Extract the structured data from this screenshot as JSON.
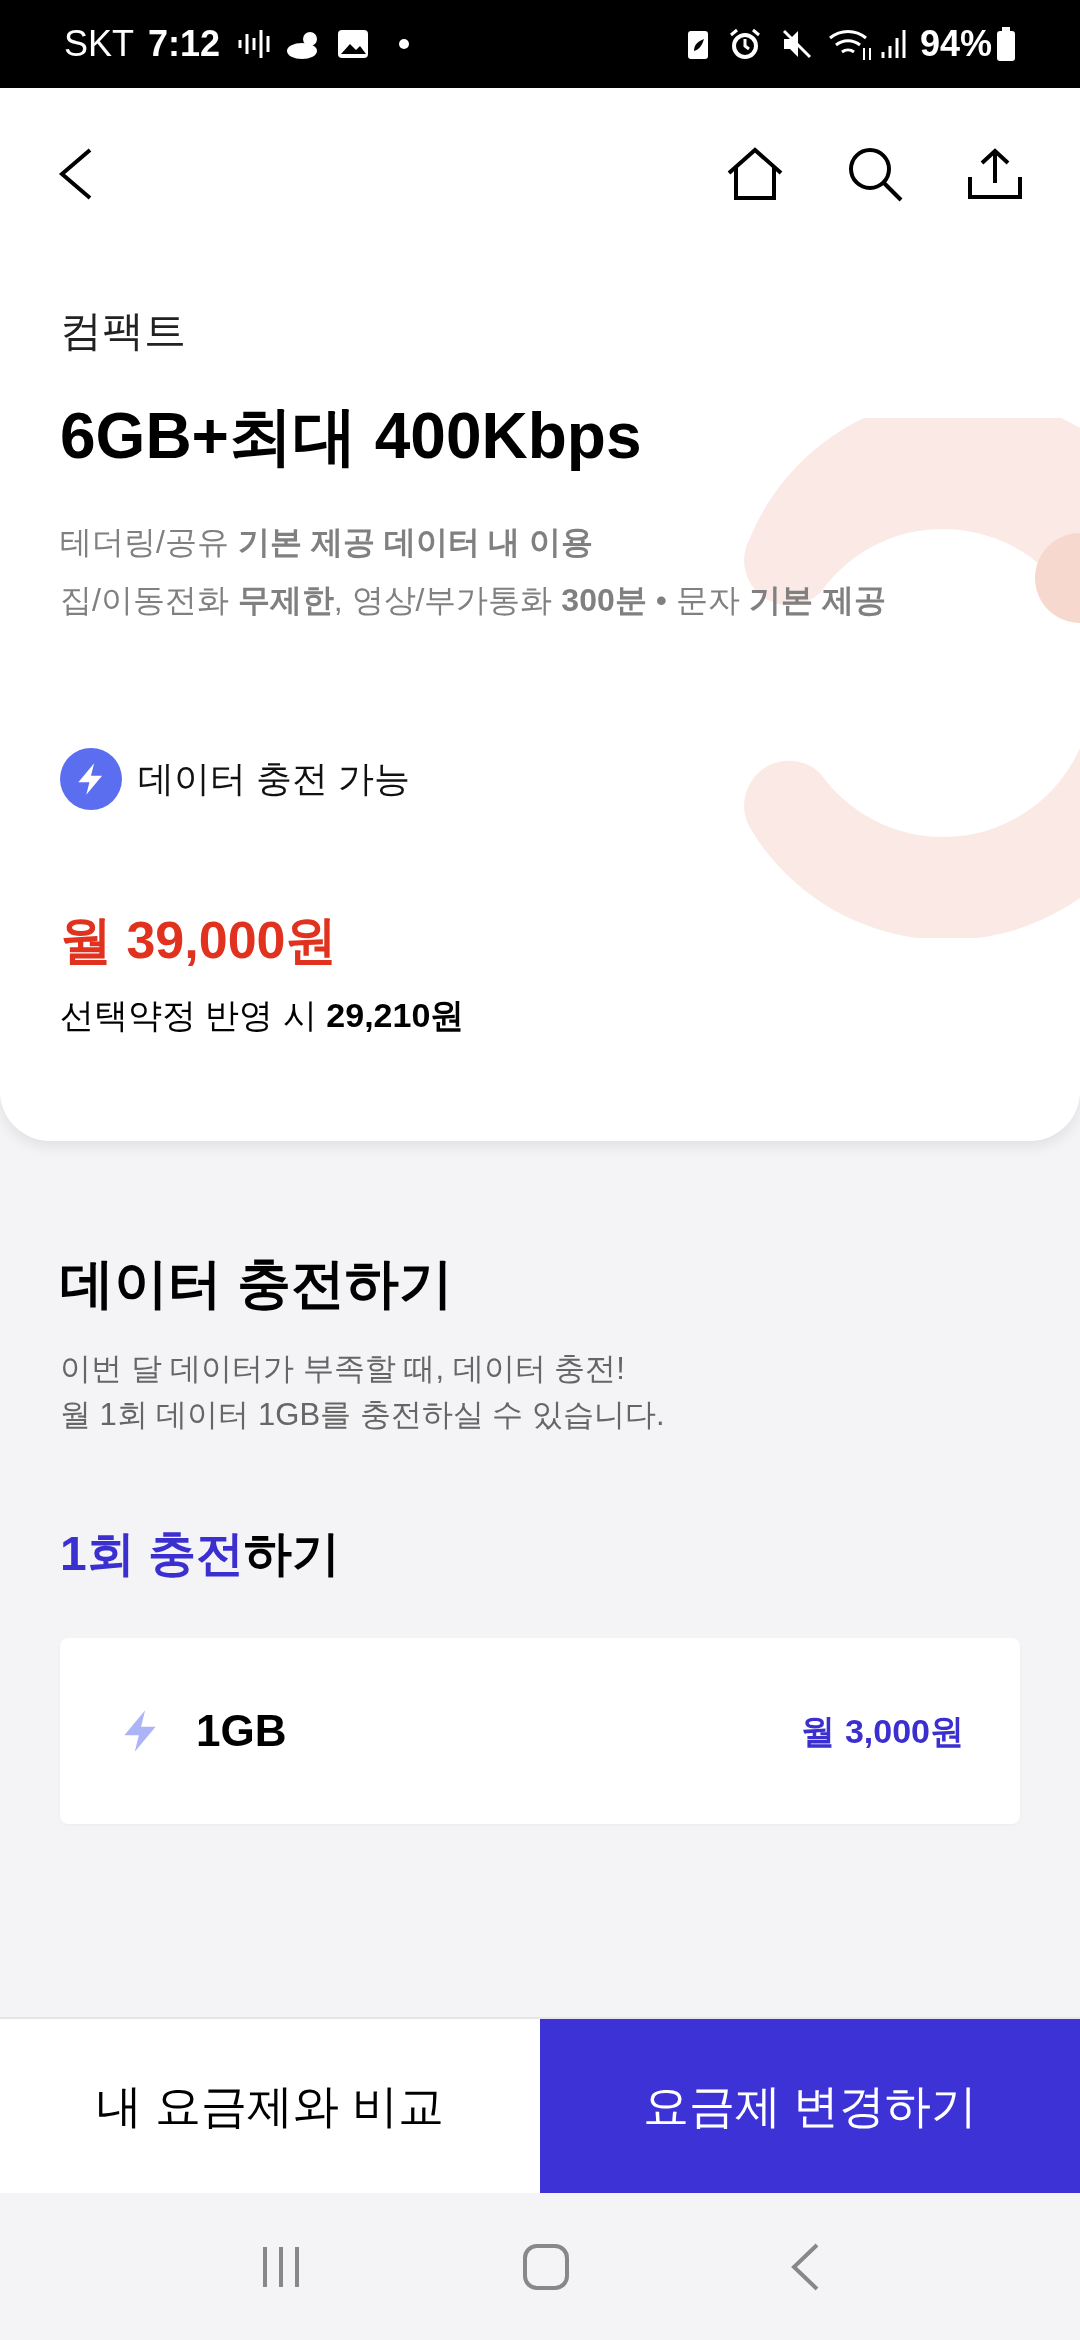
{
  "status_bar": {
    "carrier": "SKT",
    "time": "7:12",
    "battery": "94%"
  },
  "plan": {
    "category": "컴팩트",
    "title": "6GB+최대 400Kbps",
    "details": [
      "테더링/공유 **기본 제공 데이터 내 이용**",
      "집/이동전화 **무제한**, 영상/부가통화 **300분** • 문자 **기본 제공**"
    ],
    "feature": "데이터 충전 가능",
    "price": "월 39,000원",
    "discount": "선택약정 반영 시 **29,210원**"
  },
  "recharge": {
    "title": "데이터 충전하기",
    "description": [
      "이번 달 데이터가 부족할 때, 데이터 충전!",
      "월 1회 데이터 1GB를 충전하실 수 있습니다."
    ],
    "subtitle_highlight": "1회 충전",
    "subtitle_rest": "하기",
    "options": [
      {
        "amount": "1GB",
        "price": "월 3,000원"
      }
    ]
  },
  "bottom_buttons": [
    {
      "label": "내 요금제와 비교",
      "primary": false
    },
    {
      "label": "요금제 변경하기",
      "primary": true
    }
  ]
}
